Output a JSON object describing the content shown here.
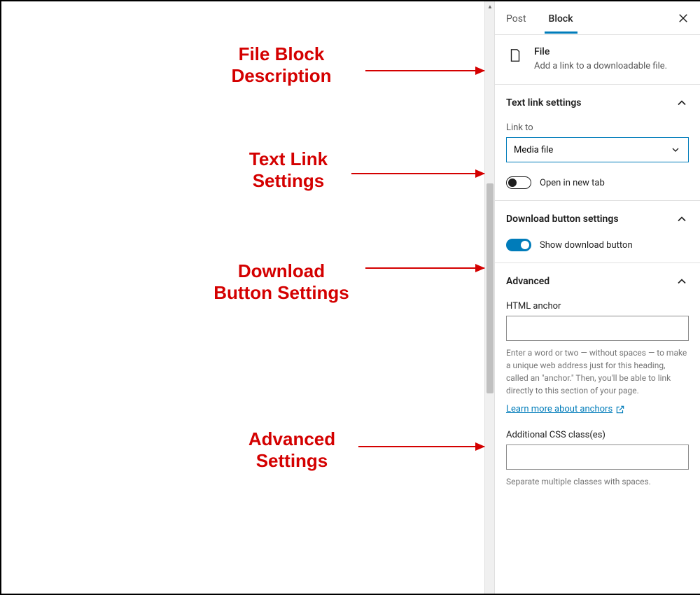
{
  "tabs": {
    "post": "Post",
    "block": "Block"
  },
  "block_desc": {
    "title": "File",
    "subtitle": "Add a link to a downloadable file."
  },
  "text_link": {
    "title": "Text link settings",
    "link_to_label": "Link to",
    "link_to_value": "Media file",
    "open_new_tab": "Open in new tab"
  },
  "download_btn": {
    "title": "Download button settings",
    "show_label": "Show download button"
  },
  "advanced": {
    "title": "Advanced",
    "anchor_label": "HTML anchor",
    "anchor_help": "Enter a word or two — without spaces — to make a unique web address just for this heading, called an \"anchor.\" Then, you'll be able to link directly to this section of your page.",
    "learn_more": "Learn more about anchors",
    "css_label": "Additional CSS class(es)",
    "css_help": "Separate multiple classes with spaces."
  },
  "annotations": {
    "a1": "File Block\nDescription",
    "a2": "Text Link\nSettings",
    "a3": "Download\nButton Settings",
    "a4": "Advanced\nSettings"
  }
}
